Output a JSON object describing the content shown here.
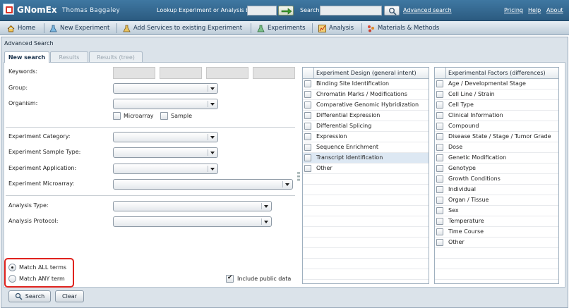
{
  "header": {
    "app_name": "GNomEx",
    "user_name": "Thomas Baggaley",
    "lookup_label": "Lookup Experiment or Analysis by #",
    "search_label": "Search",
    "advanced_search_link": "Advanced search",
    "links": {
      "pricing": "Pricing",
      "help": "Help",
      "about": "About"
    }
  },
  "nav": {
    "items": [
      {
        "label": "Home",
        "icon": "home-icon"
      },
      {
        "label": "New Experiment",
        "icon": "flask-icon"
      },
      {
        "label": "Add Services to existing Experiment",
        "icon": "flask-plus-icon"
      },
      {
        "label": "Experiments",
        "icon": "flask-icon"
      },
      {
        "label": "Analysis",
        "icon": "chart-icon"
      },
      {
        "label": "Materials & Methods",
        "icon": "molecule-icon"
      }
    ]
  },
  "panel": {
    "title": "Advanced Search",
    "tabs": [
      {
        "label": "New search",
        "active": true
      },
      {
        "label": "Results",
        "active": false
      },
      {
        "label": "Results (tree)",
        "active": false
      }
    ]
  },
  "form": {
    "keywords_label": "Keywords:",
    "group_label": "Group:",
    "organism_label": "Organism:",
    "microarray_label": "Microarray",
    "sample_label": "Sample",
    "experiment_category_label": "Experiment Category:",
    "experiment_sample_type_label": "Experiment Sample Type:",
    "experiment_application_label": "Experiment Application:",
    "experiment_microarray_label": "Experiment Microarray:",
    "analysis_type_label": "Analysis Type:",
    "analysis_protocol_label": "Analysis Protocol:",
    "match_all_label": "Match ALL terms",
    "match_any_label": "Match ANY term",
    "include_public_label": "Include public data"
  },
  "experiment_design": {
    "header": "Experiment Design (general intent)",
    "items": [
      "Binding Site Identification",
      "Chromatin Marks / Modifications",
      "Comparative Genomic Hybridization",
      "Differential Expression",
      "Differential Splicing",
      "Expression",
      "Sequence Enrichment",
      "Transcript Identification",
      "Other"
    ]
  },
  "experimental_factors": {
    "header": "Experimental Factors (differences)",
    "items": [
      "Age / Developmental Stage",
      "Cell Line / Strain",
      "Cell Type",
      "Clinical Information",
      "Compound",
      "Disease State / Stage / Tumor Grade",
      "Dose",
      "Genetic Modification",
      "Genotype",
      "Growth Conditions",
      "Individual",
      "Organ / Tissue",
      "Sex",
      "Temperature",
      "Time Course",
      "Other"
    ]
  },
  "buttons": {
    "search": "Search",
    "clear": "Clear"
  }
}
